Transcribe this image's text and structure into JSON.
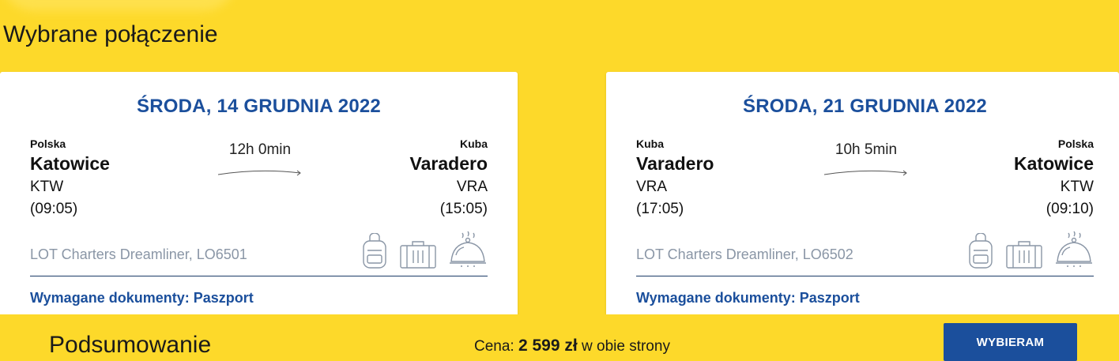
{
  "section_title": "Wybrane połączenie",
  "outbound": {
    "date": "ŚRODA, 14 GRUDNIA 2022",
    "from": {
      "country": "Polska",
      "city": "Katowice",
      "code": "KTW",
      "time": "(09:05)"
    },
    "to": {
      "country": "Kuba",
      "city": "Varadero",
      "code": "VRA",
      "time": "(15:05)"
    },
    "duration": "12h 0min",
    "aircraft": "LOT Charters Dreamliner, LO6501",
    "documents": "Wymagane dokumenty: Paszport"
  },
  "return": {
    "date": "ŚRODA, 21 GRUDNIA 2022",
    "from": {
      "country": "Kuba",
      "city": "Varadero",
      "code": "VRA",
      "time": "(17:05)"
    },
    "to": {
      "country": "Polska",
      "city": "Katowice",
      "code": "KTW",
      "time": "(09:10)"
    },
    "duration": "10h 5min",
    "aircraft": "LOT Charters Dreamliner, LO6502",
    "documents": "Wymagane dokumenty: Paszport"
  },
  "amenity_icons": [
    "backpack-icon",
    "suitcase-icon",
    "meal-cloche-icon"
  ],
  "footer": {
    "title": "Podsumowanie",
    "price_label": "Cena: ",
    "price_amount": "2 599 zł",
    "price_suffix": " w obie strony",
    "button_label": "WYBIERAM"
  },
  "colors": {
    "background": "#FDD92A",
    "accent": "#1B4F9C",
    "muted": "#8a96a6"
  }
}
